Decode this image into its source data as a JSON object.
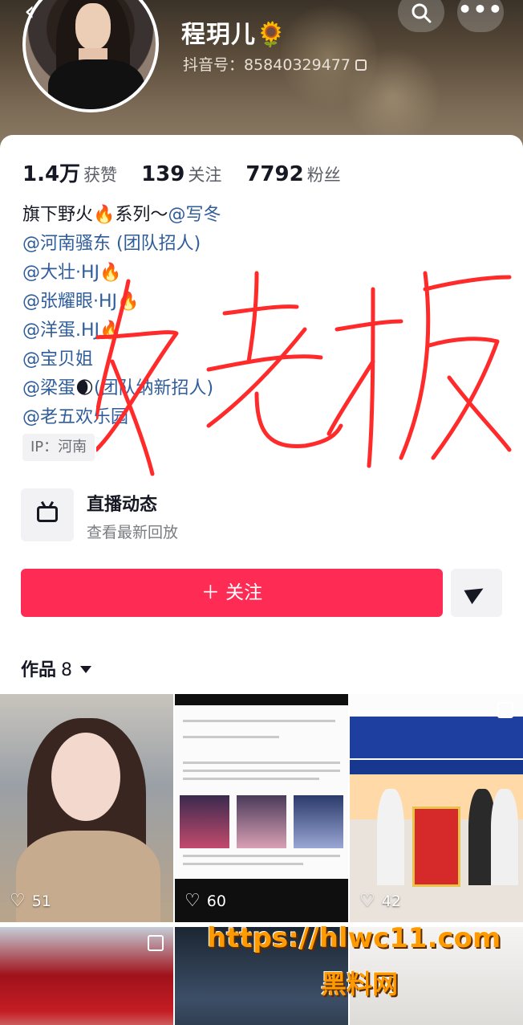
{
  "profile": {
    "name": "程玥儿🌻",
    "douyin_id": "抖音号：85840329477"
  },
  "header": {
    "back_icon": "‹",
    "search_icon": "search-icon",
    "more_icon": "•••"
  },
  "stats": [
    {
      "value": "1.4万",
      "label": "获赞"
    },
    {
      "value": "139",
      "label": "关注"
    },
    {
      "value": "7792",
      "label": "粉丝"
    }
  ],
  "bio": {
    "line1": {
      "prefix": "旗下野火",
      "fire": "🔥",
      "mid": "系列～",
      "mention": "@写冬"
    },
    "line2": "@河南骚东 (团队招人)",
    "line3": {
      "mention": "@大壮·HJ",
      "fire": "🔥"
    },
    "line4": {
      "mention": "@张耀眼·HJ",
      "fire": "🔥"
    },
    "line5": {
      "mention": "@洋蛋.HJ",
      "fire": "🔥"
    },
    "line6": "@宝贝姐",
    "line7": {
      "mention": "@梁蛋",
      "emoji": "🌒",
      "rest": "(团队纳新招人)"
    },
    "line8": "@老五欢乐园"
  },
  "ip_tag": "IP：河南",
  "live": {
    "title": "直播动态",
    "subtitle": "查看最新回放"
  },
  "actions": {
    "follow": "＋ 关注"
  },
  "works": {
    "label": "作品",
    "count": "8"
  },
  "videos": [
    {
      "likes": "51"
    },
    {
      "likes": "60"
    },
    {
      "likes": "42"
    }
  ],
  "overlay": {
    "handwriting": "女老板",
    "watermark_url": "https://hlwc11.com",
    "watermark_site": "黑料网"
  },
  "colors": {
    "follow": "#fe2c55",
    "mention": "#2f5d9b",
    "scrawl": "#ff2a2a",
    "watermark": "#ff9a00"
  }
}
